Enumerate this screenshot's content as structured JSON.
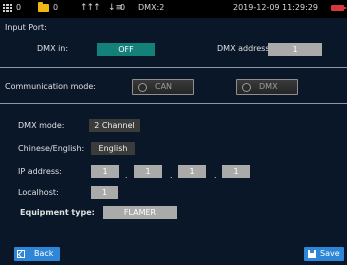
{
  "status_bar": {
    "count_1": "0",
    "count_2": "0",
    "count_3": "0",
    "dmx_status": "DMX:2",
    "datetime": "2019-12-09 11:29:29",
    "icons": [
      "grid-icon",
      "folder-icon",
      "arrows-icon",
      "sort-icon",
      "battery-icon"
    ]
  },
  "input_port": {
    "heading": "Input Port:",
    "dmx_in_label": "DMX in:",
    "dmx_in_value": "OFF",
    "dmx_address_label": "DMX address:",
    "dmx_address_value": "1"
  },
  "communication": {
    "label": "Communication mode:",
    "option_can": "CAN",
    "option_dmx": "DMX"
  },
  "settings": {
    "dmx_mode_label": "DMX mode:",
    "dmx_mode_value": "2 Channel",
    "language_label": "Chinese/English:",
    "language_value": "English",
    "ip_label": "IP address:",
    "ip_octets": [
      "1",
      "1",
      "1",
      "1"
    ],
    "ip_separator": ".",
    "localhost_label": "Localhost:",
    "localhost_value": "1",
    "equipment_label": "Equipment type:",
    "equipment_value": "FLAMER"
  },
  "footer": {
    "back_label": "Back",
    "save_label": "Save"
  },
  "colors": {
    "background": "#0a1728",
    "accent_button": "#2e86d8",
    "off_toggle": "#13807a",
    "battery": "#d9363e",
    "folder": "#f2b614"
  }
}
